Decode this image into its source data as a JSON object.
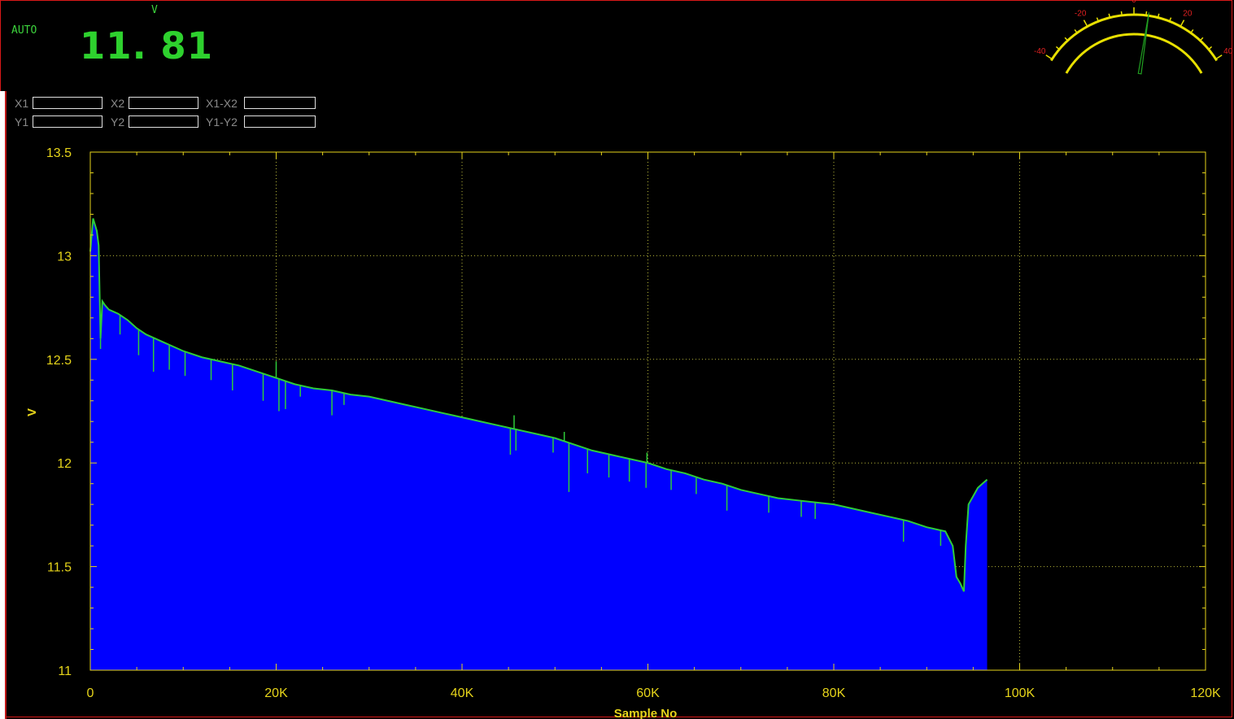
{
  "meter": {
    "mode": "AUTO",
    "unit": "V",
    "reading": "11. 81"
  },
  "gauge": {
    "ticks": [
      "-40",
      "-20",
      "0",
      "20",
      "40"
    ],
    "needle_value": 6,
    "colors": {
      "arc": "#e8e000",
      "tick_text": "#e02020",
      "needle": "#21a021"
    }
  },
  "cursors": {
    "labels": [
      "X1",
      "X2",
      "X1-X2",
      "Y1",
      "Y2",
      "Y1-Y2"
    ]
  },
  "chart_data": {
    "type": "area",
    "title": "",
    "xlabel": "Sample No",
    "ylabel": "V",
    "xlim": [
      0,
      120000
    ],
    "ylim": [
      11,
      13.5
    ],
    "x_ticks": [
      0,
      20000,
      40000,
      60000,
      80000,
      100000,
      120000
    ],
    "x_tick_labels": [
      "0",
      "20K",
      "40K",
      "60K",
      "80K",
      "100K",
      "120K"
    ],
    "y_ticks": [
      11,
      11.5,
      12,
      12.5,
      13,
      13.5
    ],
    "y_tick_labels": [
      "11",
      "11.5",
      "12",
      "12.5",
      "13",
      "13.5"
    ],
    "grid": true,
    "colors": {
      "fill": "#0000ff",
      "line": "#2ecc3a",
      "axis": "#e6d41a",
      "grid": "#b8b83a"
    },
    "series": [
      {
        "x": [
          0,
          300,
          700,
          900,
          1100,
          1300,
          1600,
          2000,
          3000,
          4000,
          5000,
          6000,
          7000,
          8000,
          9000,
          10000,
          12000,
          14000,
          16000,
          18000,
          20000,
          22000,
          24000,
          26000,
          28000,
          30000,
          32000,
          34000,
          36000,
          38000,
          40000,
          42000,
          44000,
          46000,
          48000,
          50000,
          52000,
          54000,
          56000,
          58000,
          60000,
          62000,
          64000,
          66000,
          68000,
          70000,
          72000,
          74000,
          76000,
          78000,
          80000,
          82000,
          84000,
          86000,
          88000,
          90000,
          91000,
          92000,
          92800,
          93200,
          93600,
          94000,
          94200,
          94500,
          95000,
          95500,
          96000,
          96500
        ],
        "values": [
          13.02,
          13.18,
          13.12,
          13.05,
          12.6,
          12.78,
          12.76,
          12.74,
          12.72,
          12.69,
          12.65,
          12.62,
          12.6,
          12.58,
          12.56,
          12.54,
          12.51,
          12.49,
          12.47,
          12.44,
          12.41,
          12.38,
          12.36,
          12.35,
          12.33,
          12.32,
          12.3,
          12.28,
          12.26,
          12.24,
          12.22,
          12.2,
          12.18,
          12.16,
          12.14,
          12.12,
          12.09,
          12.06,
          12.04,
          12.02,
          12.0,
          11.97,
          11.95,
          11.92,
          11.9,
          11.87,
          11.85,
          11.83,
          11.82,
          11.81,
          11.8,
          11.78,
          11.76,
          11.74,
          11.72,
          11.69,
          11.68,
          11.67,
          11.6,
          11.45,
          11.42,
          11.38,
          11.6,
          11.8,
          11.84,
          11.88,
          11.9,
          11.92
        ]
      }
    ],
    "dips": [
      {
        "x": 1100,
        "to": 12.55
      },
      {
        "x": 3200,
        "to": 12.62
      },
      {
        "x": 5200,
        "to": 12.52
      },
      {
        "x": 6800,
        "to": 12.44
      },
      {
        "x": 8500,
        "to": 12.45
      },
      {
        "x": 10200,
        "to": 12.42
      },
      {
        "x": 13000,
        "to": 12.4
      },
      {
        "x": 15300,
        "to": 12.35
      },
      {
        "x": 18600,
        "to": 12.3
      },
      {
        "x": 20300,
        "to": 12.25
      },
      {
        "x": 21000,
        "to": 12.26
      },
      {
        "x": 22600,
        "to": 12.32
      },
      {
        "x": 26000,
        "to": 12.23
      },
      {
        "x": 27300,
        "to": 12.28
      },
      {
        "x": 45200,
        "to": 12.04
      },
      {
        "x": 45800,
        "to": 12.06
      },
      {
        "x": 49800,
        "to": 12.05
      },
      {
        "x": 51500,
        "to": 11.86
      },
      {
        "x": 53500,
        "to": 11.95
      },
      {
        "x": 55800,
        "to": 11.93
      },
      {
        "x": 58000,
        "to": 11.91
      },
      {
        "x": 59800,
        "to": 11.88
      },
      {
        "x": 62500,
        "to": 11.87
      },
      {
        "x": 65200,
        "to": 11.85
      },
      {
        "x": 68500,
        "to": 11.77
      },
      {
        "x": 73000,
        "to": 11.76
      },
      {
        "x": 76500,
        "to": 11.74
      },
      {
        "x": 78000,
        "to": 11.73
      },
      {
        "x": 87500,
        "to": 11.62
      },
      {
        "x": 91500,
        "to": 11.6
      }
    ],
    "spikes": [
      {
        "x": 20000,
        "to": 12.49
      },
      {
        "x": 45600,
        "to": 12.23
      },
      {
        "x": 51000,
        "to": 12.15
      },
      {
        "x": 59900,
        "to": 12.05
      }
    ]
  }
}
